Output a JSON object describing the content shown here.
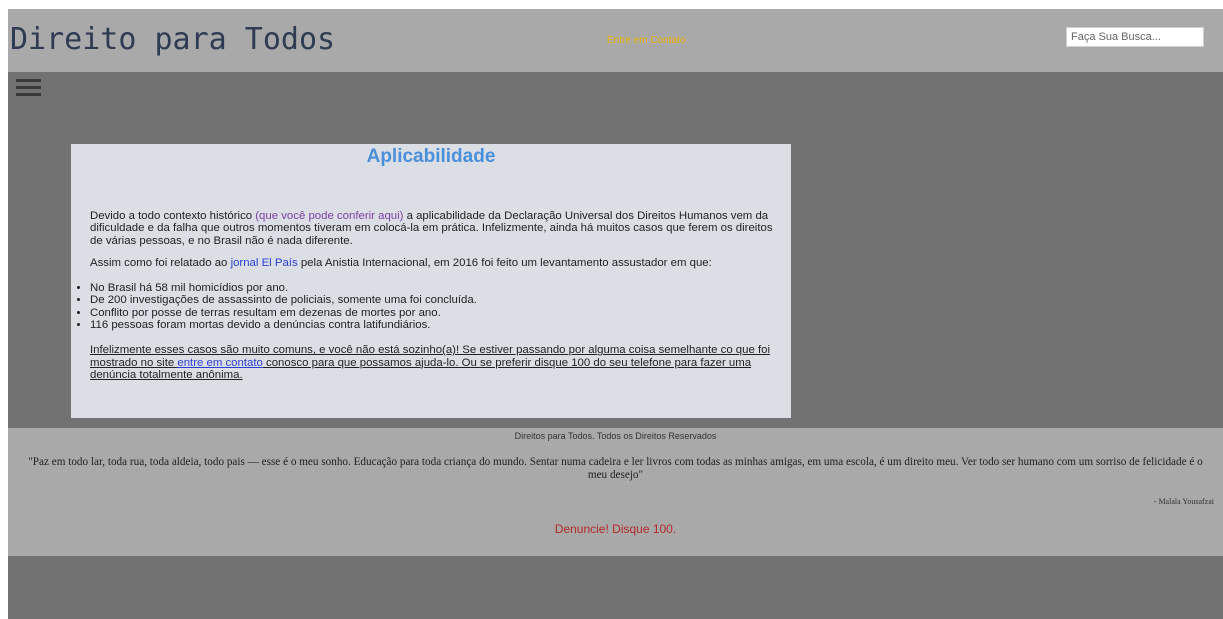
{
  "header": {
    "site_title": "Direito para Todos",
    "contact_link": "Entre em Contato",
    "search_placeholder": "Faça Sua Busca..."
  },
  "menu": {
    "icon": "hamburger-menu-icon"
  },
  "article": {
    "title": "Aplicabilidade",
    "p1_before": "Devido a todo contexto histórico ",
    "p1_link": "(que você pode conferir aqui)",
    "p1_after": " a aplicabilidade da Declaração Universal dos Direitos Humanos vem da dificuldade e da falha que outros momentos tiveram em colocá-la em prática. Infelizmente, ainda há muitos casos que ferem os direitos de várias pessoas, e no Brasil não é nada diferente.",
    "p2_before": "Assim como foi relatado ao ",
    "p2_link": "jornal El País",
    "p2_after": " pela Anistia Internacional, em 2016 foi feito um levantamento assustador em que:",
    "facts": [
      "No Brasil há 58 mil homicídios por ano.",
      "De 200 investigações de assassinto de policiais, somente uma foi concluída.",
      "Conflito por posse de terras resultam em dezenas de mortes por ano.",
      "116 pessoas foram mortas devido a denúncias contra latifundiários."
    ],
    "p3_before": "Infelizmente esses casos são muito comuns, e você não está sozinho(a)! Se estiver passando por alguma coisa semelhante co que foi mostrado no site ",
    "p3_link": "entre em contato",
    "p3_after": " conosco para que possamos ajuda-lo. Ou se preferir disque 100 do seu telefone para fazer uma denúncia totalmente anônima."
  },
  "footer": {
    "copyright": "Direitos para Todos. Todos os Direitos Reservados",
    "quote": "\"Paz em todo lar, toda rua, toda aldeia, todo pais — esse é o meu sonho. Educação para toda criança do mundo. Sentar numa cadeira e ler livros com todas as minhas amigas, em uma escola, é um direito meu. Ver todo ser humano com um sorriso de felicidade é o meu desejo\"",
    "quote_author": "- Malala Yousafzai",
    "call_to_action": "Denuncie! Disque 100."
  },
  "colors": {
    "header_bg": "#a9a9a9",
    "page_bg": "#727272",
    "card_bg": "#dcdee5",
    "title_blue": "#4a8fdb",
    "contact_orange": "#f0b400",
    "cta_red": "#b22a2a"
  }
}
